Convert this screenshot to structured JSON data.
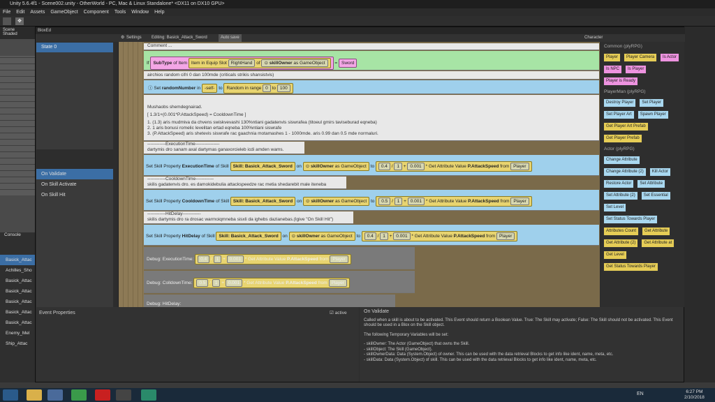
{
  "window_title": "Unity 5.6.4f1 - Scene002.unity - OtherWorld - PC, Mac & Linux Standalone* <DX11 on DX10 GPU>",
  "menu": [
    "File",
    "Edit",
    "Assets",
    "GameObject",
    "Component",
    "Tools",
    "Window",
    "Help"
  ],
  "scene_tab": "Scene",
  "scene_mode": "Shaded",
  "console_tab": "Console",
  "console_items": [
    "Basick_Attac",
    "Achilles_Sho",
    "Basick_Attac",
    "Basick_Attac",
    "Basick_Attac",
    "Basick_Attac",
    "Basick_Attac",
    "Enemy_Mel",
    "Ship_Attac"
  ],
  "bloxed_tab": "BloxEd",
  "settings_label": "Settings",
  "editing_label": "Editing: Basick_Attack_Sword",
  "autosave_label": "Auto save",
  "character_label": "Character",
  "states": [
    "State 0"
  ],
  "events": [
    "On Validate",
    "On Skill Activate",
    "On Skill Hit"
  ],
  "comment": "Comment ...",
  "if_row": {
    "if": "If",
    "subtype": "SubType",
    "of": "of Item",
    "item": "Item in Equip Slot",
    "slot": "RightHand",
    "of2": "of",
    "owner": "skillOwner",
    "as": "as GameObject",
    "eq": "=",
    "val": "Sword"
  },
  "comment2": "airchios random cifri 0 dan 100mde   (criticals strikis shansistvis)",
  "set_random": {
    "label": "Set",
    "var": "randomNumber",
    "in": "in",
    "self": "-self-",
    "to": "to",
    "range": "Random in range",
    "from": "0",
    "to_v": "100"
  },
  "comment3": [
    "Mushaobs shemdegnairad.",
    "[        1.3/1+(0.001*P.AttackSpeed) = CooldownTime          ]",
    "1. (1.3) aris mudmiva da chvens swiskvevashi 130%ntiani gadatenvis siswrafea (titoeul gmirs taviseburad eqneba)",
    "2. 1 aris bonusi romelic levelitan ertad eqneba 100%ntiani siswrafe",
    "3. (P.AttackSpeed) aris shetevis siswrafe rac gaachnia motamashes 1 - 1000mde. aris 0.99 dan 0.5 mde normaluri."
  ],
  "exec_comment": [
    "------------ExecutionTime----------------",
    "dartymis dro sanam axal dartymas ganaxorcieleb icdi amden wams."
  ],
  "exec_row": {
    "label": "Set Skill Property",
    "prop": "ExecutionTime",
    "of": "of Skill",
    "skill": "Skill: Basick_Attack_Sword",
    "on": "on",
    "owner": "skillOwner",
    "as": "as GameObject",
    "to": "to",
    "v1": "0.4",
    "slash": "/",
    "one": "1",
    "plus": "+",
    "v2": "0.001",
    "mul": "*",
    "attr": "Get Attribute Value",
    "ap": "P.AttackSpeed",
    "from": "from",
    "pl": "Player"
  },
  "cd_comment": [
    "------------CooldownTime------------",
    "skilis gadatenvis dro. es damokidebulia attackspeedze rac metia shedarebit male iteneba"
  ],
  "cd_row": {
    "prop": "CooldownTime",
    "v1": "0.5"
  },
  "hd_comment": [
    "------------HitDelay------------",
    "skilis dartymis dro ra drosac warmoiqmneba sisxli da ighebs dazianebas.(Igive \"On Skill Hit\")"
  ],
  "hd_row": {
    "prop": "HitDelay",
    "v1": "0.4"
  },
  "debug1": "Debug: ExecutionTime:",
  "debug2": "Debug: ColldownTime:",
  "debug3": "Debug: HitDelay:",
  "palette": {
    "cat1": "Common (plyRPG)",
    "common": [
      {
        "t": "Player",
        "c": "y"
      },
      {
        "t": "Player Camera",
        "c": "y"
      },
      {
        "t": "Is Actor",
        "c": "p"
      },
      {
        "t": "Is NPC",
        "c": "p"
      },
      {
        "t": "Is Player",
        "c": "p"
      },
      {
        "t": "Player is Ready",
        "c": "p"
      }
    ],
    "cat2": "PlayerMan (plyRPG)",
    "playerman": [
      {
        "t": "Destroy Player",
        "c": "b"
      },
      {
        "t": "Set Player",
        "c": "b"
      },
      {
        "t": "Set Player Art",
        "c": "b"
      },
      {
        "t": "Spawn Player",
        "c": "b"
      },
      {
        "t": "Get Player Art Prefab",
        "c": "y"
      },
      {
        "t": "Get Player Prefab",
        "c": "y"
      }
    ],
    "cat3": "Actor (plyRPG)",
    "actor": [
      {
        "t": "Change Attribute",
        "c": "b"
      },
      {
        "t": "Change Attribute (2)",
        "c": "b"
      },
      {
        "t": "Kill Actor",
        "c": "b"
      },
      {
        "t": "Restore Actor",
        "c": "b"
      },
      {
        "t": "Set Attribute",
        "c": "b"
      },
      {
        "t": "Set Attribute (2)",
        "c": "b"
      },
      {
        "t": "Set Essential",
        "c": "b"
      },
      {
        "t": "Set Level",
        "c": "b"
      },
      {
        "t": "Set Status Towards Player",
        "c": "b"
      },
      {
        "t": "Attributes Count",
        "c": "y"
      },
      {
        "t": "Get Attribute",
        "c": "y"
      },
      {
        "t": "Get Attribute (2)",
        "c": "y"
      },
      {
        "t": "Get Attribute at",
        "c": "y"
      },
      {
        "t": "Get Level",
        "c": "y"
      },
      {
        "t": "Get Status Towards Player",
        "c": "y"
      }
    ]
  },
  "event_props": "Event Properties",
  "active_label": "active",
  "help": {
    "title": "On Validate",
    "body": "Called when a skill is about to be activated. This Event should return a Boolean Value. True: The Skill may activate; False: The Skill should not be activated. This Event should be used in a Blox on the Skill object.",
    "vars": "The following Temporary Variables will be set:",
    "v1": "- skillOwner: The Actor (GameObject) that owns the Skill.",
    "v2": "- skillObject: The Skill (GameObject).",
    "v3": "- skillOwnerData: Data (System.Object) of owner. This can be used with the data retrieval Blocks to get info like ident, name, meta, etc.",
    "v4": "- skillData: Data (System.Object) of skill. This can be used with the data retrieval Blocks to get info like ident, name, meta, etc."
  },
  "tray": {
    "lang": "EN",
    "time": "6:27 PM",
    "date": "2/10/2018"
  }
}
